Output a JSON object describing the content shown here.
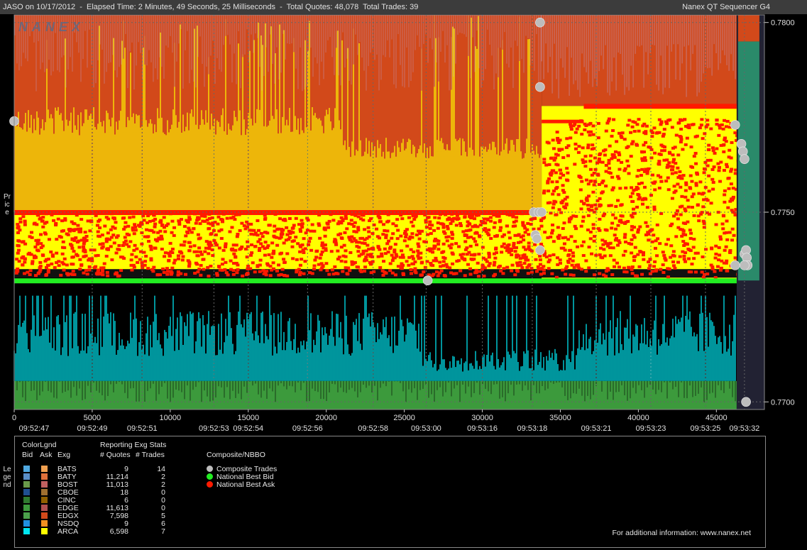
{
  "header": {
    "title": "JASO on 10/17/2012  -  Elapsed Time: 2 Minutes, 49 Seconds, 25 Milliseconds  -  Total Quotes: 48,078  Total Trades: 39",
    "product": "Nanex QT Sequencer G4",
    "watermark": "NANEX"
  },
  "side_labels": {
    "price": "Price",
    "legend": "Legend"
  },
  "colors": {
    "bid_line": "#22ee22",
    "ask_dots": "#ff1a00",
    "arca_bid": "#00e5f0",
    "arca_ask": "#ffff00",
    "edgx_ask": "#d2491a",
    "edgx_ask_light": "#c8706a",
    "edge_bid": "#3c9a3c",
    "trade_marker": "#bdbdbd",
    "grid": "#666666"
  },
  "chart_data": {
    "type": "scatter",
    "title": "JASO on 10/17/2012",
    "xlim": [
      0,
      48078
    ],
    "ylim": [
      0.7698,
      0.7802
    ],
    "y_ticks": [
      "0.7800",
      "0.7750",
      "0.7700"
    ],
    "y_tick_values": [
      0.78,
      0.775,
      0.77
    ],
    "x_ticks": [
      "0",
      "5000",
      "10000",
      "15000",
      "20000",
      "25000",
      "30000",
      "35000",
      "40000",
      "45000"
    ],
    "x_tick_values": [
      0,
      5000,
      10000,
      15000,
      20000,
      25000,
      30000,
      35000,
      40000,
      45000
    ],
    "time_labels": [
      {
        "x": 0,
        "t": "09:52:47"
      },
      {
        "x": 5000,
        "t": "09:52:49"
      },
      {
        "x": 8200,
        "t": "09:52:51"
      },
      {
        "x": 12800,
        "t": "09:52:53"
      },
      {
        "x": 15000,
        "t": "09:52:54"
      },
      {
        "x": 18800,
        "t": "09:52:56"
      },
      {
        "x": 23000,
        "t": "09:52:58"
      },
      {
        "x": 26400,
        "t": "09:53:00"
      },
      {
        "x": 30000,
        "t": "09:53:16"
      },
      {
        "x": 33200,
        "t": "09:53:18"
      },
      {
        "x": 37300,
        "t": "09:53:21"
      },
      {
        "x": 40800,
        "t": "09:53:23"
      },
      {
        "x": 44300,
        "t": "09:53:25"
      },
      {
        "x": 46800,
        "t": "09:53:32"
      }
    ],
    "series": [
      {
        "name": "National Best Bid",
        "color": "#22ee22",
        "points": [
          [
            0,
            0.7732
          ],
          [
            33800,
            0.7732
          ],
          [
            34300,
            0.7732
          ],
          [
            46300,
            0.7732
          ],
          [
            46500,
            0.7763
          ],
          [
            46700,
            0.7788
          ],
          [
            46900,
            0.7788
          ],
          [
            47300,
            0.7732
          ]
        ]
      },
      {
        "name": "National Best Ask",
        "color": "#ff1a00",
        "points": [
          [
            0,
            0.775
          ],
          [
            33300,
            0.775
          ],
          [
            33800,
            0.7775
          ],
          [
            34300,
            0.7774
          ],
          [
            36500,
            0.7778
          ],
          [
            46300,
            0.7778
          ],
          [
            46500,
            0.7795
          ],
          [
            47300,
            0.7795
          ]
        ]
      },
      {
        "name": "Composite Trades",
        "color": "#bdbdbd",
        "points": [
          [
            0,
            0.7774
          ],
          [
            26500,
            0.7732
          ],
          [
            33300,
            0.775
          ],
          [
            33400,
            0.7744
          ],
          [
            33500,
            0.7743
          ],
          [
            33600,
            0.775
          ],
          [
            33700,
            0.78
          ],
          [
            33700,
            0.7783
          ],
          [
            33800,
            0.775
          ],
          [
            33700,
            0.774
          ],
          [
            46200,
            0.7773
          ],
          [
            46200,
            0.7736
          ],
          [
            46600,
            0.7768
          ],
          [
            46700,
            0.7766
          ],
          [
            46800,
            0.7764
          ],
          [
            46800,
            0.7739
          ],
          [
            46900,
            0.774
          ],
          [
            46950,
            0.7738
          ],
          [
            47000,
            0.7736
          ],
          [
            46800,
            0.7736
          ],
          [
            46900,
            0.77
          ]
        ]
      }
    ]
  },
  "legend": {
    "colorlgnd_label": "ColorLgnd",
    "reporting_label": "Reporting Exg Stats",
    "col_bid": "Bid",
    "col_ask": "Ask",
    "col_exg": "Exg",
    "col_quotes": "# Quotes",
    "col_trades": "# Trades",
    "rows": [
      {
        "exg": "BATS",
        "bid": "#4fa8e0",
        "ask": "#f0a050",
        "quotes": "9",
        "trades": "14"
      },
      {
        "exg": "BATY",
        "bid": "#5a8fc8",
        "ask": "#e0703a",
        "quotes": "11,214",
        "trades": "2"
      },
      {
        "exg": "BOST",
        "bid": "#6a9a4a",
        "ask": "#c06060",
        "quotes": "11,013",
        "trades": "2"
      },
      {
        "exg": "CBOE",
        "bid": "#1f4f90",
        "ask": "#a07030",
        "quotes": "18",
        "trades": "0"
      },
      {
        "exg": "CINC",
        "bid": "#2f7a2f",
        "ask": "#906000",
        "quotes": "6",
        "trades": "0"
      },
      {
        "exg": "EDGE",
        "bid": "#3c9a3c",
        "ask": "#b05050",
        "quotes": "11,613",
        "trades": "0"
      },
      {
        "exg": "EDGX",
        "bid": "#4aa04a",
        "ask": "#d2491a",
        "quotes": "7,598",
        "trades": "5"
      },
      {
        "exg": "NSDQ",
        "bid": "#2090e0",
        "ask": "#f09020",
        "quotes": "9",
        "trades": "6"
      },
      {
        "exg": "ARCA",
        "bid": "#00e5f0",
        "ask": "#ffff00",
        "quotes": "6,598",
        "trades": "7"
      }
    ],
    "composite_title": "Composite/NBBO",
    "composite_items": [
      {
        "label": "Composite Trades",
        "color": "#bdbdbd"
      },
      {
        "label": "National Best Bid",
        "color": "#22ee22"
      },
      {
        "label": "National Best Ask",
        "color": "#ff1a00"
      }
    ],
    "info": "For additional information: www.nanex.net"
  }
}
